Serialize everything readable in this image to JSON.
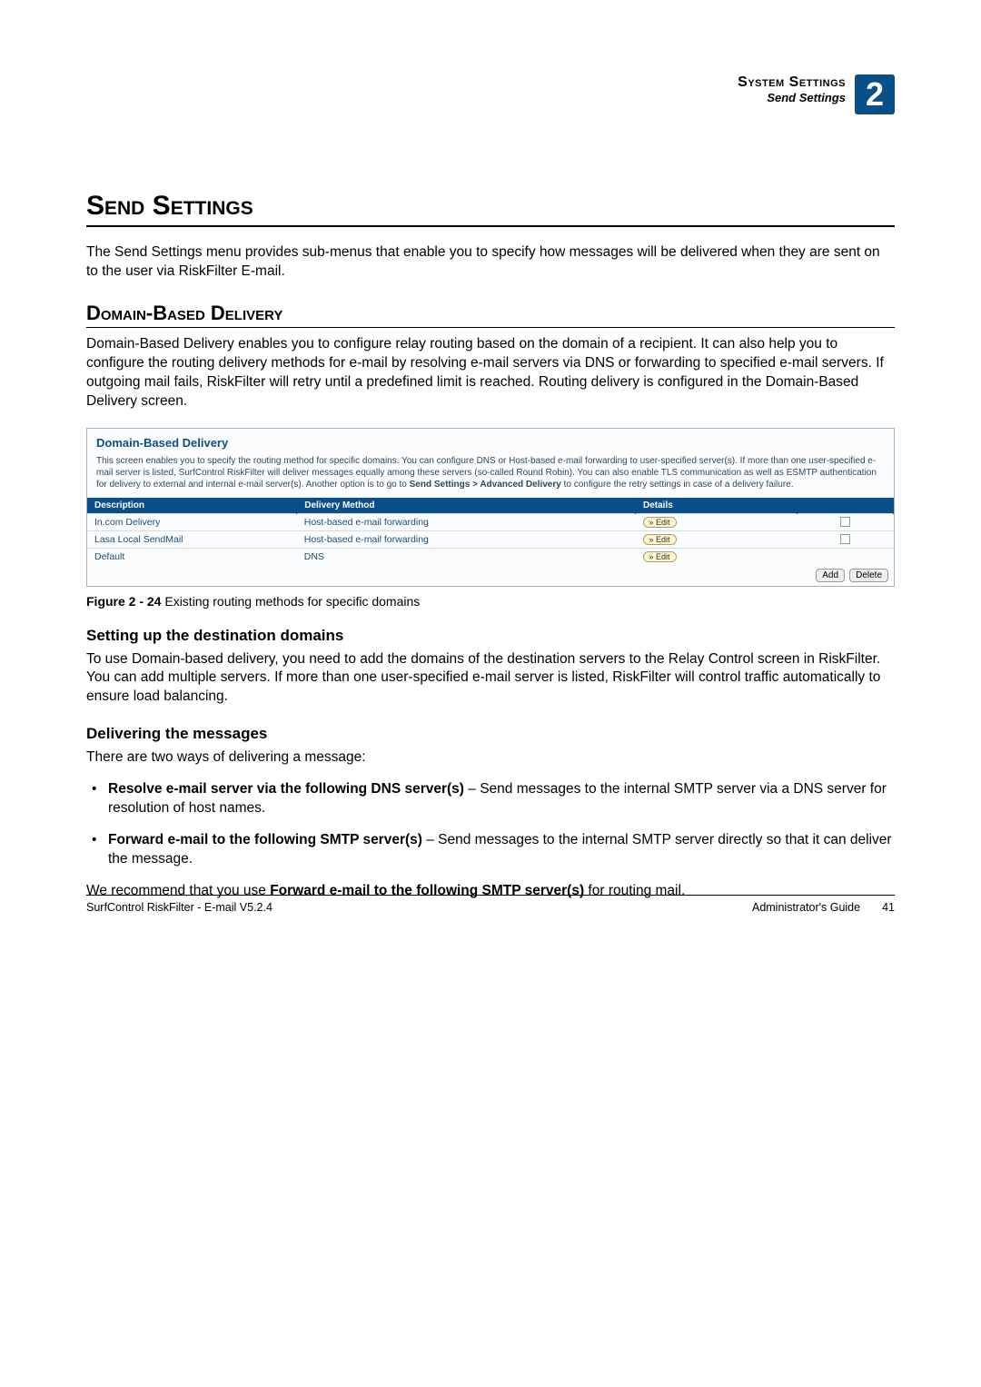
{
  "header": {
    "category": "System Settings",
    "section": "Send Settings",
    "chapter_number": "2"
  },
  "heading1": "Send Settings",
  "intro": "The Send Settings menu provides sub-menus that enable you to specify how messages will be delivered when they are sent on to the user via RiskFilter E-mail.",
  "heading2": "Domain-Based Delivery",
  "domain_para": "Domain-Based Delivery enables you to configure relay routing based on the domain of a recipient. It can also help you to configure the routing delivery methods for e-mail by resolving e-mail servers via DNS or forwarding to specified e-mail servers. If outgoing mail fails, RiskFilter will retry until a predefined limit is reached. Routing delivery is configured in the Domain-Based Delivery screen.",
  "figure": {
    "panel_title": "Domain-Based Delivery",
    "panel_desc_pre": "This screen enables you to specify the routing method for specific domains. You can configure DNS or Host-based e-mail forwarding to user-specified server(s). If more than one user-specified e-mail server is listed, SurfControl RiskFilter will deliver messages equally among these servers (so-called Round Robin). You can also enable TLS communication as well as ESMTP authentication for delivery to external and internal e-mail server(s). Another option is to go to ",
    "panel_desc_bold": "Send Settings > Advanced Delivery",
    "panel_desc_post": " to configure the retry settings in case of a delivery failure.",
    "cols": {
      "c1": "Description",
      "c2": "Delivery Method",
      "c3": "Details",
      "c4": ""
    },
    "rows": [
      {
        "desc": "In.com Delivery",
        "method": "Host-based e-mail forwarding",
        "btn": "» Edit",
        "chk": true
      },
      {
        "desc": "Lasa Local SendMail",
        "method": "Host-based e-mail forwarding",
        "btn": "» Edit",
        "chk": true
      },
      {
        "desc": "Default",
        "method": "DNS",
        "btn": "» Edit",
        "chk": false
      }
    ],
    "add_btn": "Add",
    "del_btn": "Delete",
    "caption_prefix": "Figure 2 - 24 ",
    "caption_text": "Existing routing methods for specific domains"
  },
  "h3a": "Setting up the destination domains",
  "h3a_para": "To use Domain-based delivery, you need to add the domains of the destination servers to the Relay Control screen in RiskFilter. You can add multiple servers. If more than one user-specified e-mail server is listed, RiskFilter will control traffic automatically to ensure load balancing.",
  "h3b": "Delivering the messages",
  "h3b_intro": "There are two ways of delivering a message:",
  "bullets": [
    {
      "lead": "Resolve e-mail server via the following DNS server(s)",
      "rest": " – Send messages to the internal SMTP server via a DNS server for resolution of host names."
    },
    {
      "lead": "Forward e-mail to the following SMTP server(s)",
      "rest": " – Send messages to the internal SMTP server directly so that it can deliver the message."
    }
  ],
  "reco_pre": "We recommend that you use ",
  "reco_bold": "Forward e-mail to the following SMTP server(s)",
  "reco_post": " for routing mail.",
  "footer": {
    "left": "SurfControl RiskFilter - E-mail V5.2.4",
    "right_label": "Administrator's Guide",
    "page": "41"
  }
}
